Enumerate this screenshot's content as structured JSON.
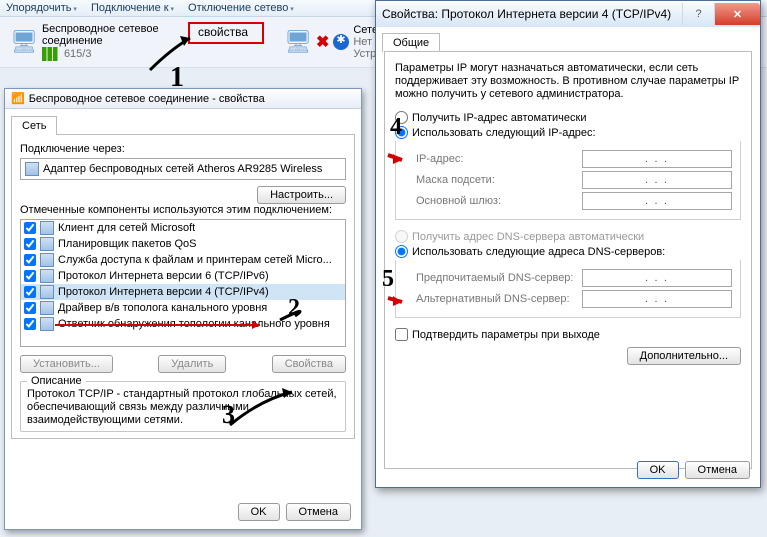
{
  "menubar": [
    "Упорядочить",
    "Подключение к",
    "Отключение сетево"
  ],
  "tiles": {
    "wifi": {
      "title": "Беспроводное сетевое",
      "title2": "соединение",
      "sub": "615/3",
      "props_label": "свойства"
    },
    "other": {
      "title": "Сетев…",
      "sub1": "Нет по",
      "sub2": "Устро"
    }
  },
  "dialog1": {
    "title": "Беспроводное сетевое соединение - свойства",
    "tab": "Сеть",
    "connect_via": "Подключение через:",
    "adapter": "Адаптер беспроводных сетей Atheros AR9285 Wireless",
    "configure": "Настроить...",
    "used_components": "Отмеченные компоненты используются этим подключением:",
    "components": [
      "Клиент для сетей Microsoft",
      "Планировщик пакетов QoS",
      "Служба доступа к файлам и принтерам сетей Micro...",
      "Протокол Интернета версии 6 (TCP/IPv6)",
      "Протокол Интернета версии 4 (TCP/IPv4)",
      "Драйвер в/в тополога канального уровня",
      "Ответчик обнаружения топологии канального уровня"
    ],
    "install": "Установить...",
    "uninstall": "Удалить",
    "properties": "Свойства",
    "desc_title": "Описание",
    "desc_text": "Протокол TCP/IP - стандартный протокол глобальных сетей, обеспечивающий связь между различными взаимодействующими сетями.",
    "ok": "OK",
    "cancel": "Отмена"
  },
  "dialog2": {
    "title": "Свойства: Протокол Интернета версии 4 (TCP/IPv4)",
    "tab": "Общие",
    "intro": "Параметры IP могут назначаться автоматически, если сеть поддерживает эту возможность. В противном случае параметры IP можно получить у сетевого администратора.",
    "r_auto_ip": "Получить IP-адрес автоматически",
    "r_manual_ip": "Использовать следующий IP-адрес:",
    "ip_addr": "IP-адрес:",
    "mask": "Маска подсети:",
    "gateway": "Основной шлюз:",
    "r_auto_dns": "Получить адрес DNS-сервера автоматически",
    "r_manual_dns": "Использовать следующие адреса DNS-серверов:",
    "dns1": "Предпочитаемый DNS-сервер:",
    "dns2": "Альтернативный DNS-сервер:",
    "confirm_exit": "Подтвердить параметры при выходе",
    "advanced": "Дополнительно...",
    "ok": "OK",
    "cancel": "Отмена",
    "ip_placeholder": ".       .       ."
  }
}
